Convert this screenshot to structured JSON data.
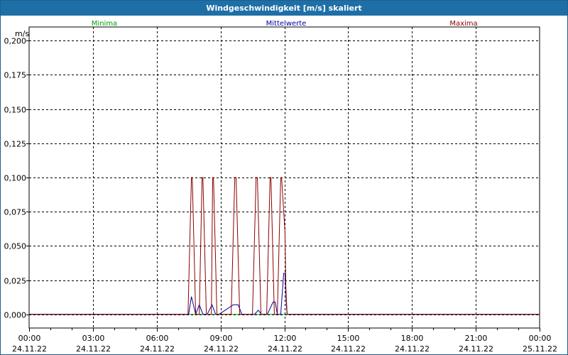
{
  "window": {
    "title": "Windgeschwindigkeit [m/s] skaliert"
  },
  "colors": {
    "minima": "#00a000",
    "mittelwerte": "#0000a0",
    "maxima": "#8b0000",
    "grid": "#000000"
  },
  "chart_data": {
    "type": "line",
    "title": "Windgeschwindigkeit [m/s] skaliert",
    "ylabel": "m/s",
    "xlabel": "",
    "ylim": [
      -0.01,
      0.21
    ],
    "xlim_hours": [
      0,
      24
    ],
    "grid": true,
    "legend_position": "top",
    "y_ticks": [
      "0,200",
      "0,175",
      "0,150",
      "0,125",
      "0,100",
      "0,075",
      "0,050",
      "0,025",
      "0,000"
    ],
    "y_tick_values": [
      0.2,
      0.175,
      0.15,
      0.125,
      0.1,
      0.075,
      0.05,
      0.025,
      0.0
    ],
    "x_ticks": [
      {
        "time": "00:00",
        "date": "24.11.22"
      },
      {
        "time": "03:00",
        "date": "24.11.22"
      },
      {
        "time": "06:00",
        "date": "24.11.22"
      },
      {
        "time": "09:00",
        "date": "24.11.22"
      },
      {
        "time": "12:00",
        "date": "24.11.22"
      },
      {
        "time": "15:00",
        "date": "24.11.22"
      },
      {
        "time": "18:00",
        "date": "24.11.22"
      },
      {
        "time": "21:00",
        "date": "24.11.22"
      },
      {
        "time": "00:00",
        "date": "25.11.22"
      }
    ],
    "series": [
      {
        "name": "Minima",
        "color": "#00a000",
        "x": [
          0,
          24
        ],
        "y": [
          0,
          0
        ]
      },
      {
        "name": "Mittelwerte",
        "color": "#0000a0",
        "x": [
          0,
          7.5,
          7.63,
          7.83,
          8.0,
          8.17,
          8.37,
          8.6,
          8.77,
          8.93,
          9.6,
          9.83,
          10.0,
          10.2,
          10.6,
          10.77,
          10.93,
          11.2,
          11.47,
          11.57,
          11.67,
          11.83,
          11.97,
          12.03,
          12.1,
          12.13,
          24
        ],
        "y": [
          0,
          0,
          0.013,
          0,
          0.007,
          0,
          0,
          0.007,
          0,
          0,
          0.007,
          0.007,
          0,
          0,
          0,
          0.003,
          0,
          0,
          0.009,
          0.009,
          0,
          0,
          0.03,
          0.03,
          0.005,
          0,
          0
        ]
      },
      {
        "name": "Maxima",
        "color": "#8b0000",
        "x": [
          0,
          7.47,
          7.63,
          7.67,
          7.83,
          8.0,
          8.13,
          8.17,
          8.33,
          8.57,
          8.63,
          8.67,
          8.83,
          9.5,
          9.67,
          9.73,
          9.9,
          10.5,
          10.67,
          10.73,
          10.9,
          11.17,
          11.33,
          11.37,
          11.53,
          11.67,
          11.83,
          11.87,
          12.03,
          12.07,
          12.13,
          24
        ],
        "y": [
          0,
          0,
          0.1,
          0.1,
          0,
          0,
          0.1,
          0.1,
          0,
          0,
          0.1,
          0.1,
          0,
          0,
          0.1,
          0.1,
          0,
          0,
          0.1,
          0.1,
          0,
          0,
          0.1,
          0.1,
          0,
          0,
          0.1,
          0.1,
          0.06,
          0.02,
          0,
          0
        ]
      }
    ]
  }
}
